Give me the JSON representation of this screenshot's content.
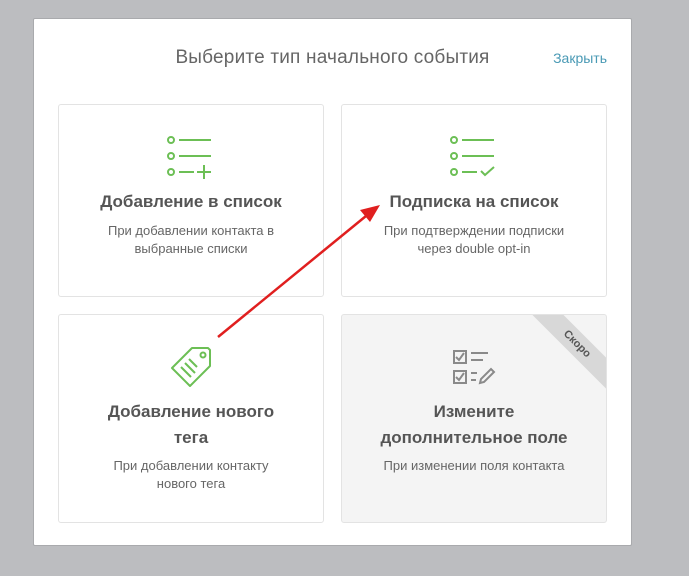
{
  "modal": {
    "title": "Выберите тип начального события",
    "close_label": "Закрыть"
  },
  "cards": [
    {
      "icon": "list-add-icon",
      "title": "Добавление в список",
      "desc_line1": "При добавлении контакта в",
      "desc_line2": "выбранные списки"
    },
    {
      "icon": "list-check-icon",
      "title": "Подписка на список",
      "desc_line1": "При подтверждении подписки",
      "desc_line2": "через double opt-in"
    },
    {
      "icon": "tag-icon",
      "title_line1": "Добавление нового",
      "title_line2": "тега",
      "desc_line1": "При добавлении контакту",
      "desc_line2": "нового тега"
    },
    {
      "icon": "form-edit-icon",
      "title_line1": "Измените",
      "title_line2": "дополнительное поле",
      "desc_line1": "При изменении поля контакта",
      "badge": "Скоро"
    }
  ],
  "colors": {
    "accent_green": "#6cbf55",
    "link_blue": "#4a9ab5",
    "icon_gray": "#8a8a8a",
    "arrow_red": "#e01f1f"
  }
}
